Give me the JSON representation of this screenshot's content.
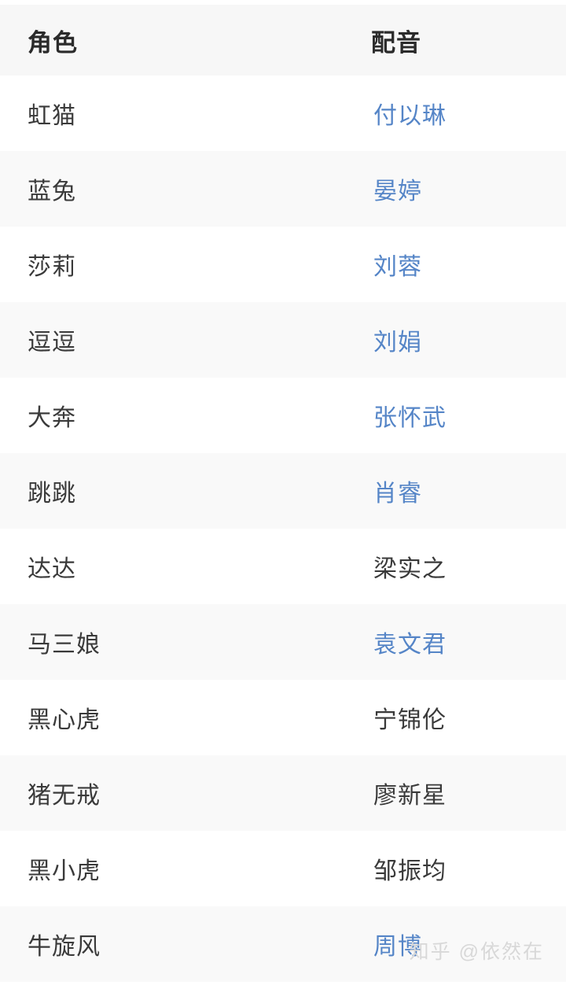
{
  "table": {
    "columns": [
      {
        "key": "role",
        "label": "角色"
      },
      {
        "key": "voice",
        "label": "配音"
      }
    ],
    "rows": [
      {
        "role": "虹猫",
        "voice": "付以琳",
        "voice_is_link": true
      },
      {
        "role": "蓝兔",
        "voice": "晏婷",
        "voice_is_link": true
      },
      {
        "role": "莎莉",
        "voice": "刘蓉",
        "voice_is_link": true
      },
      {
        "role": "逗逗",
        "voice": "刘娟",
        "voice_is_link": true
      },
      {
        "role": "大奔",
        "voice": "张怀武",
        "voice_is_link": true
      },
      {
        "role": "跳跳",
        "voice": "肖睿",
        "voice_is_link": true
      },
      {
        "role": "达达",
        "voice": "梁实之",
        "voice_is_link": false
      },
      {
        "role": "马三娘",
        "voice": "袁文君",
        "voice_is_link": true
      },
      {
        "role": "黑心虎",
        "voice": "宁锦伦",
        "voice_is_link": false
      },
      {
        "role": "猪无戒",
        "voice": "廖新星",
        "voice_is_link": false
      },
      {
        "role": "黑小虎",
        "voice": "邹振均",
        "voice_is_link": false
      },
      {
        "role": "牛旋风",
        "voice": "周博",
        "voice_is_link": true
      }
    ]
  },
  "watermark": {
    "text": "知乎 @依然在"
  },
  "colors": {
    "link": "#5585c7",
    "text": "#3a3a3a",
    "header_text": "#2b2b2b",
    "header_bg": "#f7f7f7",
    "row_alt_bg": "#f9f9f9",
    "row_bg": "#ffffff",
    "watermark": "#d8d8d8"
  }
}
